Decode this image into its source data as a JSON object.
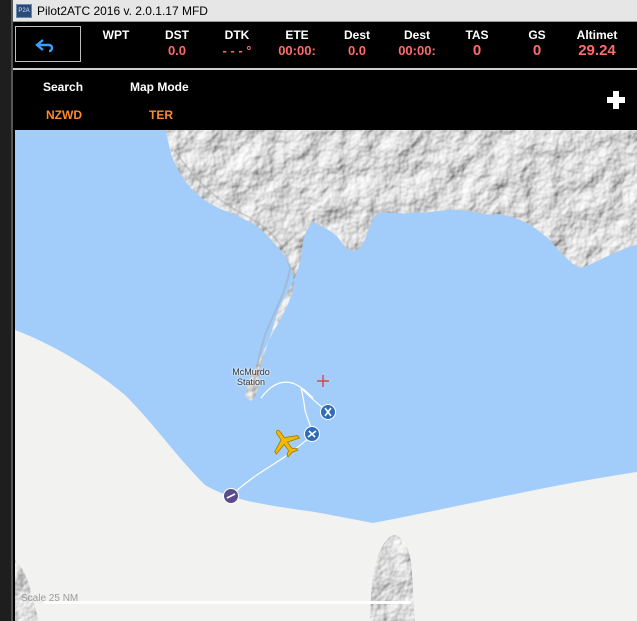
{
  "window": {
    "title": "Pilot2ATC 2016 v. 2.0.1.17 MFD",
    "icon_label": "P2A"
  },
  "instruments": [
    {
      "label": "WPT",
      "value": ""
    },
    {
      "label": "DST",
      "value": "0.0"
    },
    {
      "label": "DTK",
      "value": "- - - °"
    },
    {
      "label": "ETE",
      "value": "00:00:"
    },
    {
      "label": "Dest",
      "value": "0.0"
    },
    {
      "label": "Dest",
      "value": "00:00:"
    },
    {
      "label": "TAS",
      "value": "0"
    },
    {
      "label": "GS",
      "value": "0"
    },
    {
      "label": "Altimet",
      "value": "29.24"
    }
  ],
  "controls": {
    "search_label": "Search",
    "search_value": "NZWD",
    "map_mode_label": "Map Mode",
    "map_mode_value": "TER"
  },
  "map": {
    "station_line1": "McMurdo",
    "station_line2": "Station",
    "scale_text": "Scale 25 NM",
    "colors": {
      "water": "#a2cdfa",
      "land": "#f2f2f0",
      "route": "#ffffff",
      "aircraft": "#f5b800",
      "waypoint": "#2e6db8",
      "origin": "#5b4a8c",
      "value": "#ff6a6a",
      "control_value": "#ff8a2a"
    }
  },
  "icons": [
    "back-arrow-icon",
    "plus-icon",
    "aircraft-icon",
    "waypoint-icon",
    "crosshair-icon"
  ]
}
